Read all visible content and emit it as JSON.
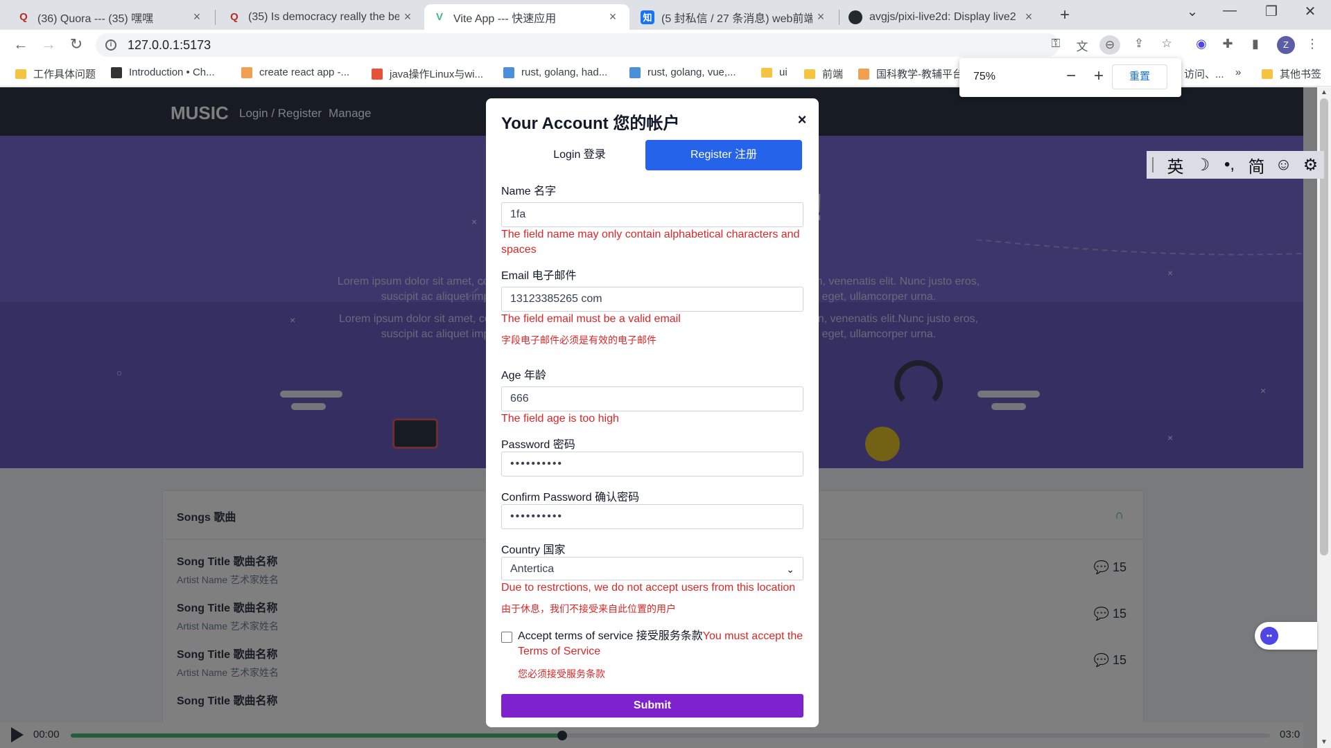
{
  "browser": {
    "tabs": [
      {
        "title": "(36) Quora --- (35) 嘿嘿",
        "icon": "quora-icon"
      },
      {
        "title": "(35) Is democracy really the be",
        "icon": "quora-icon"
      },
      {
        "title": "Vite App --- 快速应用",
        "icon": "vite-icon"
      },
      {
        "title": "(5 封私信 / 27 条消息) web前端",
        "icon": "zhihu-icon"
      },
      {
        "title": "avgjs/pixi-live2d: Display live2",
        "icon": "github-icon"
      }
    ],
    "url": "127.0.0.1:5173",
    "zoom": {
      "percent": "75%",
      "reset_label": "重置"
    },
    "bookmarks": [
      "工作具体问题",
      "Introduction • Ch...",
      "create react app -...",
      "java操作Linux与wi...",
      "rust, golang, had...",
      "rust, golang, vue,...",
      "ui",
      "前端",
      "国科教学-教辅平台",
      "访问、...",
      "»",
      "其他书签"
    ],
    "profile_initial": "Z",
    "zhihu_favicon_text": "知"
  },
  "site": {
    "brand": "MUSIC",
    "nav": [
      "Login / Register",
      "Manage"
    ],
    "hero_text_1": "Lorem ipsum dolor sit amet, consectetur adipiscing elit. Vivamus et dolor mollis, congue augue non, venenatis elit. Nunc justo eros, suscipit ac aliquet imperdiet, venenatis et sapien. Duis sed magna pulvinar, fringilla lorem eget, ullamcorper urna.",
    "hero_text_2": "Lorem ipsum dolor sit amet, consectetur adipiscing elit. Vivamus et dolor mollis, congue augue non, venenatis elit.Nunc justo eros, suscipit ac aliquet imperdiet, venenatis et sapien. Duis sed magna pulvinar, fringilla lorem eget, ullamcorper urna.",
    "hero_title": "!",
    "songs": {
      "title": "Songs 歌曲",
      "items": [
        {
          "title": "Song Title 歌曲名称",
          "artist": "Artist Name 艺术家姓名",
          "comments": "15"
        },
        {
          "title": "Song Title 歌曲名称",
          "artist": "Artist Name 艺术家姓名",
          "comments": "15"
        },
        {
          "title": "Song Title 歌曲名称",
          "artist": "Artist Name 艺术家姓名",
          "comments": "15"
        },
        {
          "title": "Song Title 歌曲名称",
          "artist": "",
          "comments": ""
        }
      ]
    },
    "player": {
      "current": "00:00",
      "duration": "03:0",
      "progress": 0.41
    }
  },
  "ime": {
    "items": [
      "英",
      "☽",
      "•,",
      "简",
      "☺",
      "⚙"
    ]
  },
  "modal": {
    "title": "Your Account 您的帐户",
    "close": "×",
    "tabs": {
      "login": "Login 登录",
      "register": "Register 注册"
    },
    "fields": {
      "name": {
        "label": "Name 名字",
        "value": "1fa",
        "error": "The field name may only contain alphabetical characters and spaces"
      },
      "email": {
        "label": "Email 电子邮件",
        "value": "13123385265 com",
        "error": "The field email must be a valid email",
        "error_zh": "字段电子邮件必须是有效的电子邮件"
      },
      "age": {
        "label": "Age 年龄",
        "value": "666",
        "error": "The field age is too high"
      },
      "password": {
        "label": "Password 密码",
        "value": "••••••••••"
      },
      "confirm_password": {
        "label": "Confirm Password 确认密码",
        "value": "••••••••••"
      },
      "country": {
        "label": "Country 国家",
        "value": "Antertica",
        "error": "Due to restrctions, we do not accept users from this location",
        "error_zh": "由于休息，我们不接受来自此位置的用户"
      }
    },
    "terms": {
      "label": "Accept terms of service 接受服务条款",
      "error": "You must accept the Terms of Service",
      "error_zh": "您必须接受服务条款"
    },
    "submit": "Submit"
  },
  "colors": {
    "primary": "#2563eb",
    "submit": "#7e22ce",
    "error": "#dc2626",
    "hero": "#7a6cd4",
    "nav": "#2d3748"
  }
}
